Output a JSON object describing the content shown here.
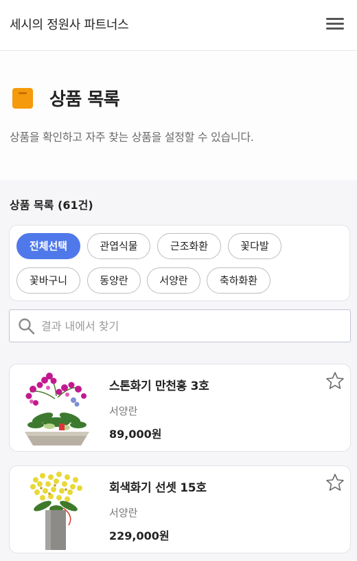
{
  "header": {
    "title": "세시의 정원사 파트너스",
    "menu_icon": "hamburger-menu-icon"
  },
  "hero": {
    "icon": "box-icon",
    "icon_color": "#f59a0c",
    "title": "상품 목록",
    "description": "상품을 확인하고 자주 찾는 상품을 설정할 수 있습니다."
  },
  "list": {
    "heading": "상품 목록 (61건)",
    "filters": [
      {
        "label": "전체선택",
        "active": true
      },
      {
        "label": "관엽식물",
        "active": false
      },
      {
        "label": "근조화환",
        "active": false
      },
      {
        "label": "꽃다발",
        "active": false
      },
      {
        "label": "꽃바구니",
        "active": false
      },
      {
        "label": "동양란",
        "active": false
      },
      {
        "label": "서양란",
        "active": false
      },
      {
        "label": "축하화환",
        "active": false
      }
    ],
    "search": {
      "placeholder": "결과 내에서 찾기",
      "value": ""
    },
    "products": [
      {
        "name": "스톤화기 만천홍 3호",
        "category": "서양란",
        "price": "89,000원",
        "favorite": false,
        "image": "purple-orchid-in-stone-bowl"
      },
      {
        "name": "회색화기 선셋 15호",
        "category": "서양란",
        "price": "229,000원",
        "favorite": false,
        "image": "yellow-orchid-in-grey-vase"
      }
    ]
  },
  "colors": {
    "accent": "#4f78ea",
    "background": "#f6f6f8"
  }
}
